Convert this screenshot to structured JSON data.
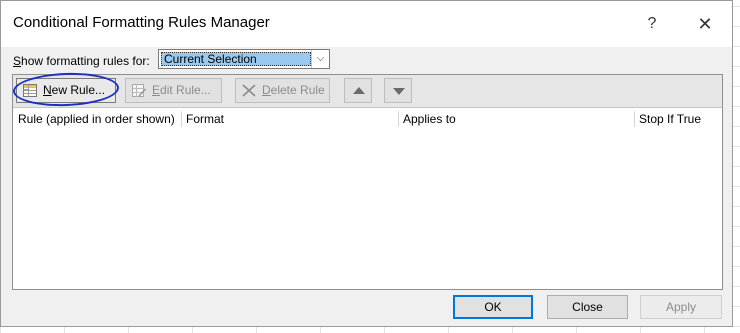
{
  "dialog": {
    "title": "Conditional Formatting Rules Manager",
    "help_glyph": "?",
    "close_glyph": "✕"
  },
  "show_rules": {
    "label_prefix": "",
    "label_access_key": "S",
    "label_rest": "how formatting rules for:",
    "selected_value": "Current Selection",
    "dropdown_glyph": "⌵"
  },
  "toolbar": {
    "new_rule": {
      "access_key": "N",
      "rest": "ew Rule...",
      "icon": "new-rule-icon"
    },
    "edit_rule": {
      "access_key": "E",
      "rest": "dit Rule...",
      "icon": "edit-rule-icon",
      "enabled": false
    },
    "delete_rule": {
      "access_key": "D",
      "rest": "elete Rule",
      "icon": "delete-x-icon",
      "enabled": false
    },
    "move_up": {
      "icon": "move-up-arrow-icon"
    },
    "move_down": {
      "icon": "move-down-arrow-icon"
    }
  },
  "columns": [
    "Rule (applied in order shown)",
    "Format",
    "Applies to",
    "Stop If True"
  ],
  "rules": [],
  "buttons": {
    "ok": "OK",
    "close": "Close",
    "apply": "Apply"
  },
  "colors": {
    "selection_highlight": "#99c9ef",
    "annotation_circle": "#1c2fbf",
    "default_button_border": "#0078d7"
  }
}
